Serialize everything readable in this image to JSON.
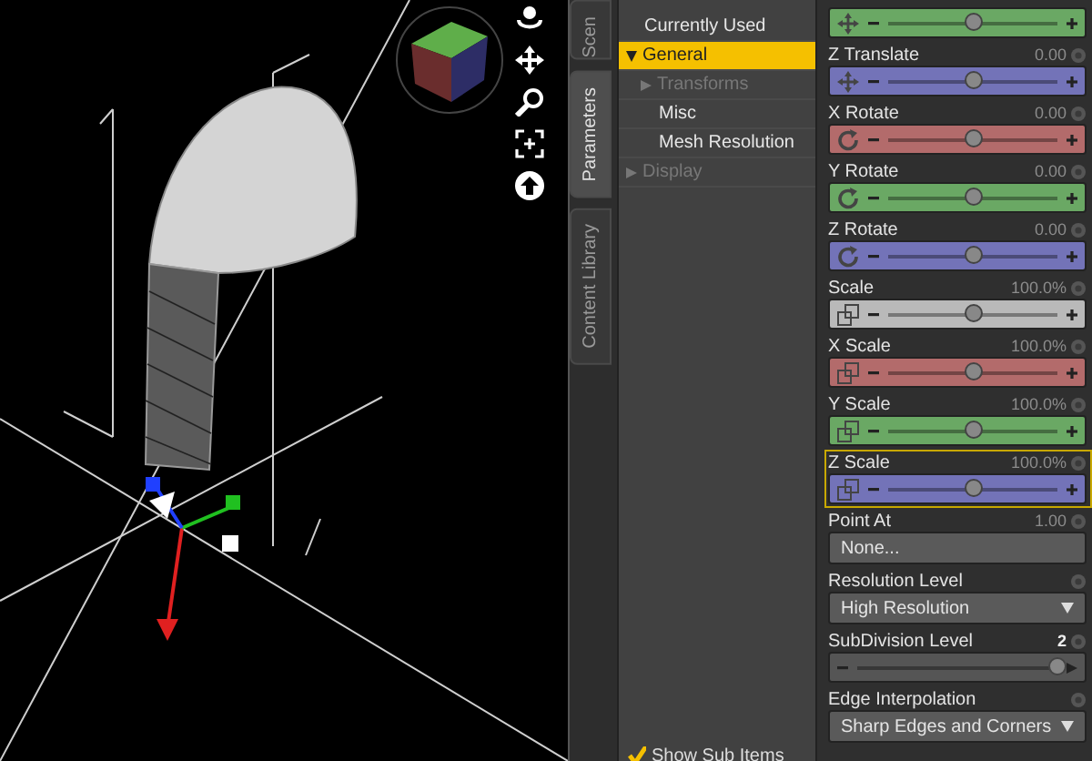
{
  "side_tabs": [
    {
      "label": "Scen",
      "selected": false
    },
    {
      "label": "Parameters",
      "selected": true
    },
    {
      "label": "Content Library",
      "selected": false
    }
  ],
  "categories": [
    {
      "label": "Currently Used",
      "selected": false,
      "disabled": false
    },
    {
      "label": "General",
      "selected": true,
      "disabled": false,
      "expanded": true,
      "children": [
        {
          "label": "Transforms",
          "selected": false,
          "disabled": true,
          "expanded": false
        },
        {
          "label": "Misc",
          "selected": false,
          "disabled": false
        },
        {
          "label": "Mesh Resolution",
          "selected": false,
          "disabled": false
        }
      ]
    },
    {
      "label": "Display",
      "selected": false,
      "disabled": true,
      "expanded": false
    }
  ],
  "show_sub_items": {
    "label": "Show Sub Items",
    "checked": true
  },
  "parameters": [
    {
      "kind": "translate",
      "color": "#6aa864",
      "level": 0.5,
      "selected": false
    },
    {
      "kind": "translate",
      "label": "Z Translate",
      "value": "0.00",
      "color": "#7373b8",
      "level": 0.5,
      "selected": false
    },
    {
      "kind": "rotate",
      "label": "X Rotate",
      "value": "0.00",
      "color": "#b36b6b",
      "level": 0.5,
      "selected": false
    },
    {
      "kind": "rotate",
      "label": "Y Rotate",
      "value": "0.00",
      "color": "#6aa864",
      "level": 0.5,
      "selected": false
    },
    {
      "kind": "rotate",
      "label": "Z Rotate",
      "value": "0.00",
      "color": "#7373b8",
      "level": 0.5,
      "selected": false
    },
    {
      "kind": "scale",
      "label": "Scale",
      "value": "100.0%",
      "color": "#b9b9b9",
      "level": 0.5,
      "selected": false
    },
    {
      "kind": "scale",
      "label": "X Scale",
      "value": "100.0%",
      "color": "#b36b6b",
      "level": 0.5,
      "selected": false
    },
    {
      "kind": "scale",
      "label": "Y Scale",
      "value": "100.0%",
      "color": "#6aa864",
      "level": 0.5,
      "selected": false
    },
    {
      "kind": "scale",
      "label": "Z Scale",
      "value": "100.0%",
      "color": "#7373b8",
      "level": 0.5,
      "selected": true
    },
    {
      "kind": "button",
      "label": "Point At",
      "value": "1.00",
      "text": "None...",
      "selected": false
    },
    {
      "kind": "dropdown",
      "label": "Resolution Level",
      "text": "High Resolution",
      "selected": false
    },
    {
      "kind": "int_slider",
      "label": "SubDivision Level",
      "value": "2",
      "level": 1.0,
      "selected": false
    },
    {
      "kind": "dropdown",
      "label": "Edge Interpolation",
      "text": "Sharp Edges and Corners",
      "selected": false
    }
  ]
}
